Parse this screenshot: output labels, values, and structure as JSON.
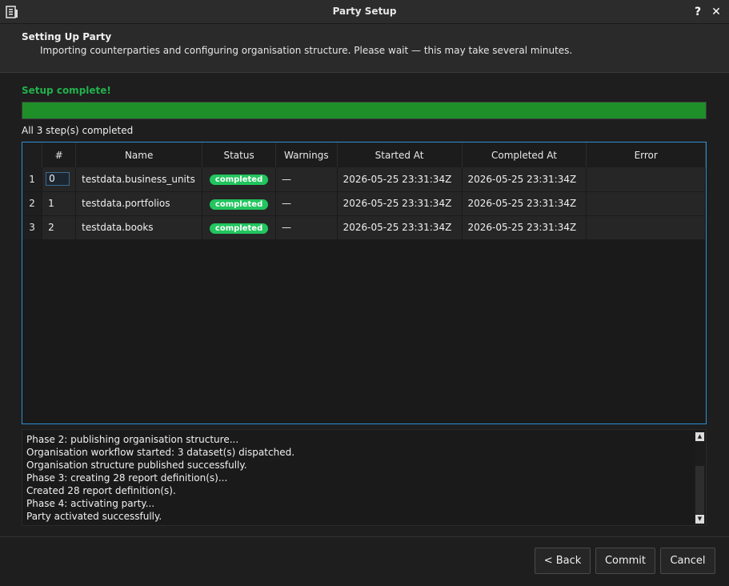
{
  "window": {
    "title": "Party Setup",
    "help_glyph": "?",
    "close_glyph": "✕"
  },
  "header": {
    "title": "Setting Up Party",
    "subtitle": "Importing counterparties and configuring organisation structure. Please wait — this may take several minutes."
  },
  "progress": {
    "status": "Setup complete!",
    "fraction": 1.0,
    "summary": "All 3 step(s) completed"
  },
  "table": {
    "columns": [
      "#",
      "Name",
      "Status",
      "Warnings",
      "Started At",
      "Completed At",
      "Error"
    ],
    "rows": [
      {
        "row": "1",
        "index": "0",
        "name": "testdata.business_units",
        "status": "completed",
        "warnings": "—",
        "started": "2026-05-25 23:31:34Z",
        "completed": "2026-05-25 23:31:34Z",
        "error": ""
      },
      {
        "row": "2",
        "index": "1",
        "name": "testdata.portfolios",
        "status": "completed",
        "warnings": "—",
        "started": "2026-05-25 23:31:34Z",
        "completed": "2026-05-25 23:31:34Z",
        "error": ""
      },
      {
        "row": "3",
        "index": "2",
        "name": "testdata.books",
        "status": "completed",
        "warnings": "—",
        "started": "2026-05-25 23:31:34Z",
        "completed": "2026-05-25 23:31:34Z",
        "error": ""
      }
    ]
  },
  "log": {
    "lines": [
      "Phase 2: publishing organisation structure...",
      "Organisation workflow started: 3 dataset(s) dispatched.",
      "Organisation structure published successfully.",
      "Phase 3: creating 28 report definition(s)...",
      "Created 28 report definition(s).",
      "Phase 4: activating party...",
      "Party activated successfully."
    ]
  },
  "buttons": {
    "back": "< Back",
    "commit": "Commit",
    "cancel": "Cancel"
  },
  "colors": {
    "success": "#22b14c",
    "progress_fill": "#1f8f2a",
    "badge": "#22c55e",
    "accent_border": "#2d8fd6"
  }
}
